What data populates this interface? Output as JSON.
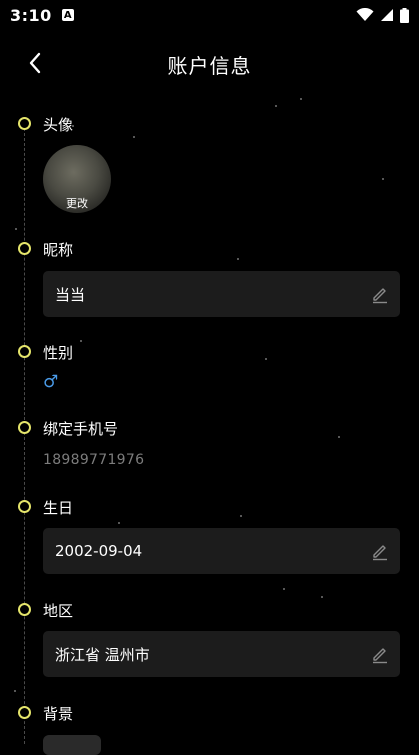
{
  "status_bar": {
    "time": "3:10",
    "badge": "A"
  },
  "app_bar": {
    "title": "账户信息",
    "back_icon": "chevron-left-icon"
  },
  "avatar_section": {
    "label": "头像",
    "change_label": "更改"
  },
  "nickname": {
    "label": "昵称",
    "value": "当当"
  },
  "gender": {
    "label": "性别",
    "value": "♂"
  },
  "phone": {
    "label": "绑定手机号",
    "value": "18989771976"
  },
  "birthday": {
    "label": "生日",
    "value": "2002-09-04"
  },
  "region": {
    "label": "地区",
    "value": "浙江省 温州市"
  },
  "background": {
    "label": "背景"
  },
  "colors": {
    "accent": "#e5e56b",
    "male": "#4a9be8",
    "field_bg": "#1c1c1c"
  }
}
